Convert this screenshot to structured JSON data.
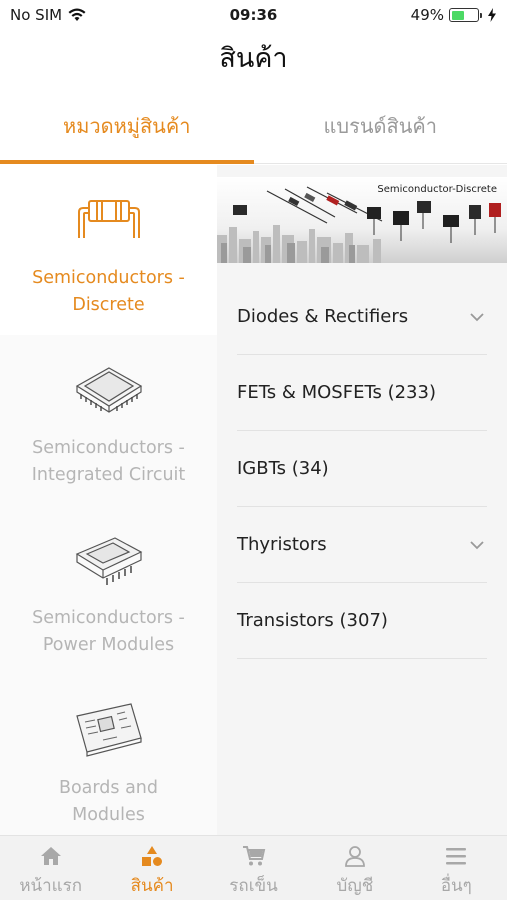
{
  "status": {
    "carrier": "No SIM",
    "time": "09:36",
    "battery_percent": "49%",
    "battery_level": 0.49
  },
  "nav": {
    "title": "สินค้า"
  },
  "tabs": [
    {
      "label": "หมวดหมู่สินค้า",
      "active": true
    },
    {
      "label": "แบรนด์สินค้า",
      "active": false
    }
  ],
  "categories": [
    {
      "label": "Semiconductors -\nDiscrete",
      "icon": "resistor-icon",
      "active": true
    },
    {
      "label": "Semiconductors -\nIntegrated Circuit",
      "icon": "ic-chip-icon",
      "active": false
    },
    {
      "label": "Semiconductors -\nPower Modules",
      "icon": "power-module-icon",
      "active": false
    },
    {
      "label": "Boards and\nModules",
      "icon": "circuit-board-icon",
      "active": false
    }
  ],
  "banner": {
    "title": "Semiconductor-Discrete"
  },
  "subcategories": [
    {
      "label": "Diodes & Rectifiers",
      "expandable": true
    },
    {
      "label": "FETs & MOSFETs (233)",
      "expandable": false
    },
    {
      "label": "IGBTs (34)",
      "expandable": false
    },
    {
      "label": "Thyristors",
      "expandable": true
    },
    {
      "label": "Transistors (307)",
      "expandable": false
    }
  ],
  "bottom_nav": [
    {
      "label": "หน้าแรก",
      "icon": "home-icon",
      "active": false
    },
    {
      "label": "สินค้า",
      "icon": "products-icon",
      "active": true
    },
    {
      "label": "รถเข็น",
      "icon": "cart-icon",
      "active": false
    },
    {
      "label": "บัญชี",
      "icon": "user-icon",
      "active": false
    },
    {
      "label": "อื่นๆ",
      "icon": "menu-icon",
      "active": false
    }
  ],
  "colors": {
    "accent": "#e58a1f",
    "inactive": "#b5b5b5",
    "battery": "#4cd964"
  }
}
